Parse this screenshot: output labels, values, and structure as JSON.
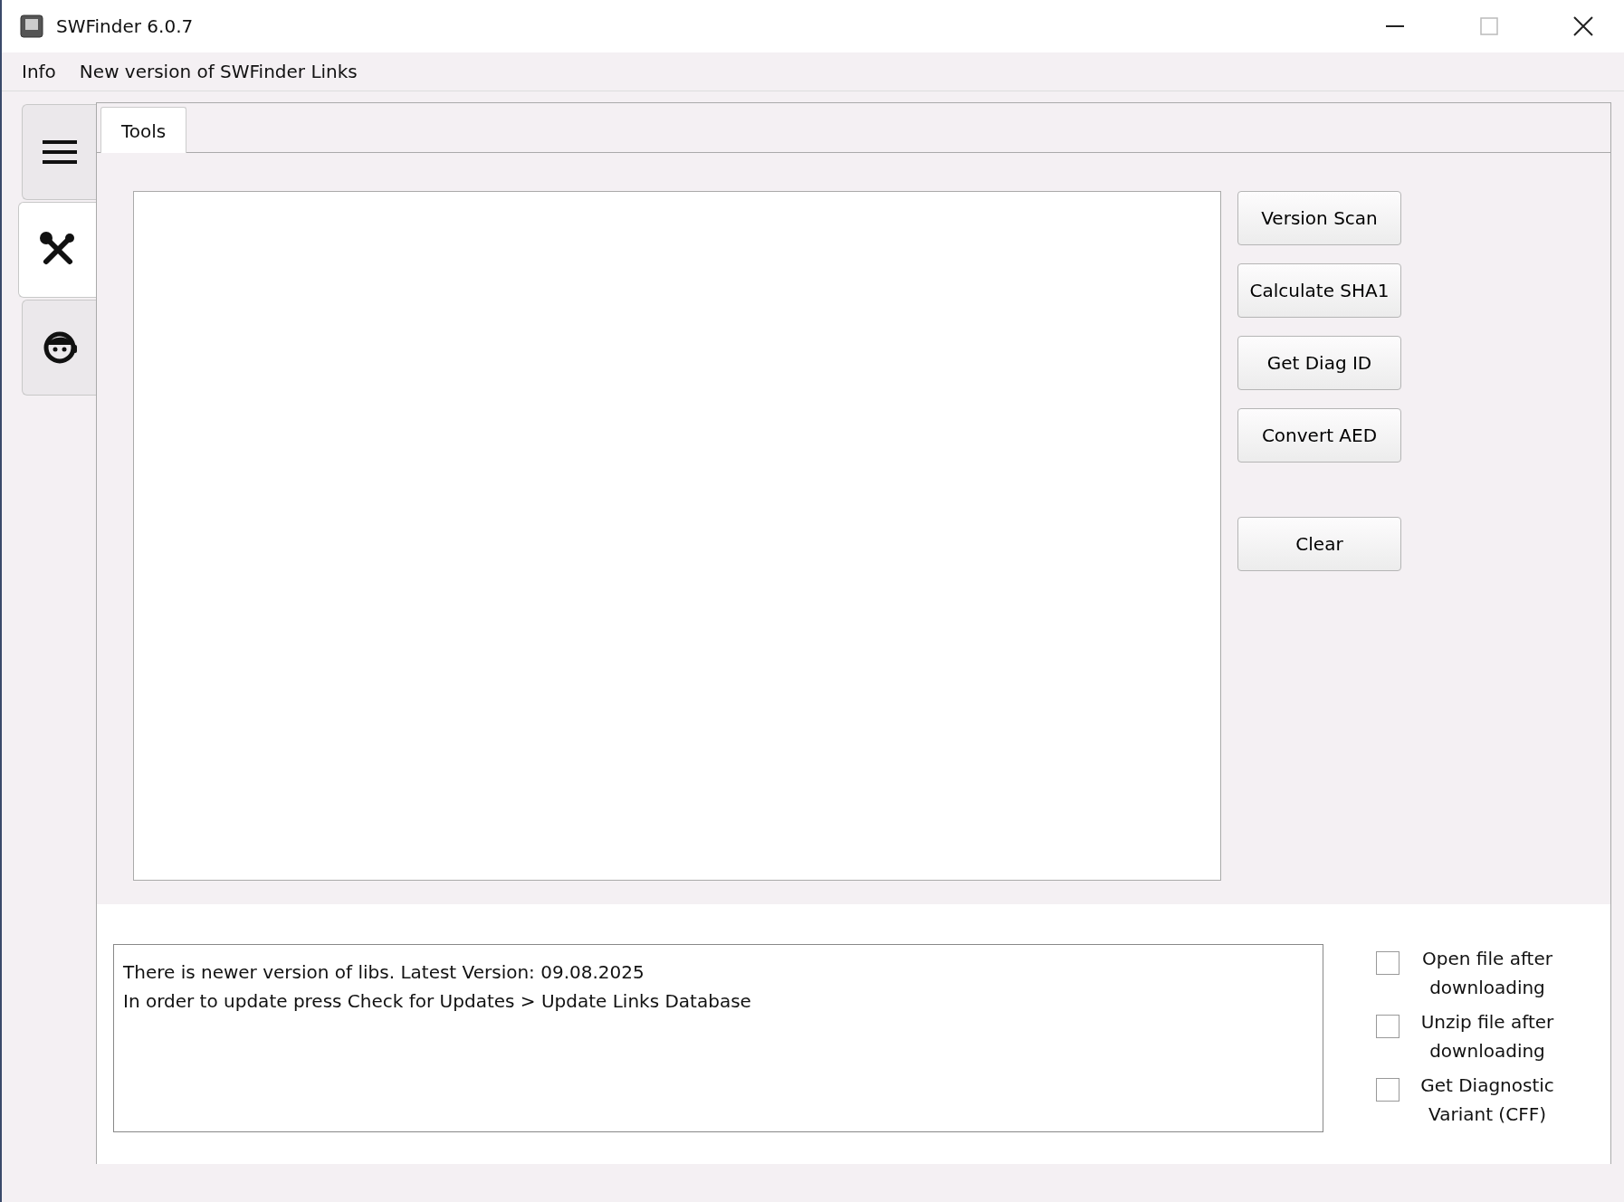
{
  "window": {
    "title": "SWFinder 6.0.7"
  },
  "menu": [
    "Info",
    "New version of SWFinder Links"
  ],
  "sidebar": {
    "items": [
      {
        "kind": "menu",
        "selected": false
      },
      {
        "kind": "tools",
        "selected": true
      },
      {
        "kind": "support",
        "selected": false
      }
    ]
  },
  "tabs": [
    {
      "label": "Tools",
      "selected": true
    }
  ],
  "button_groups": [
    {
      "buttons": [
        "Version Scan",
        "Calculate SHA1",
        "Get Diag ID",
        "Convert AED"
      ]
    },
    {
      "buttons": [
        "Clear"
      ]
    }
  ],
  "log": {
    "lines": [
      "There is newer version of libs. Latest Version: 09.08.2025",
      "In order to update press Check for Updates > Update Links Database"
    ]
  },
  "options": [
    {
      "label": "Open file after downloading",
      "checked": false
    },
    {
      "label": "Unzip file after downloading",
      "checked": false
    },
    {
      "label": "Get Diagnostic Variant (CFF)",
      "checked": false
    }
  ]
}
